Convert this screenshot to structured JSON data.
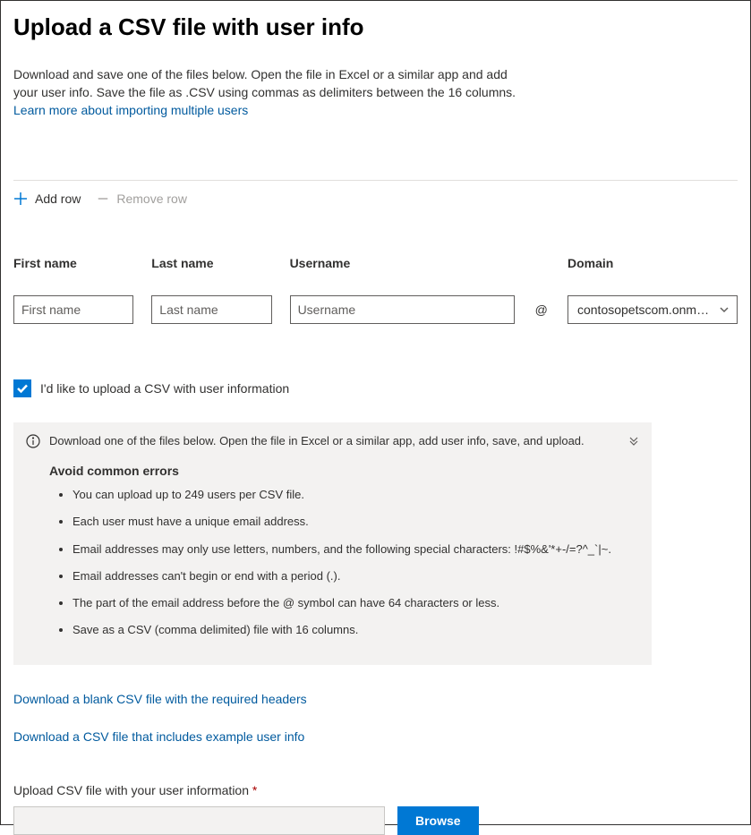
{
  "header": {
    "title": "Upload a CSV file with user info",
    "intro": "Download and save one of the files below. Open the file in Excel or a similar app and add your user info. Save the file as .CSV using commas as delimiters between the 16 columns.",
    "learn_link": "Learn more about importing multiple users"
  },
  "toolbar": {
    "add_row": "Add row",
    "remove_row": "Remove row"
  },
  "fields": {
    "first_name": {
      "label": "First name",
      "placeholder": "First name"
    },
    "last_name": {
      "label": "Last name",
      "placeholder": "Last name"
    },
    "username": {
      "label": "Username",
      "placeholder": "Username"
    },
    "at": "@",
    "domain": {
      "label": "Domain",
      "value": "contosopetscom.onmic..."
    }
  },
  "checkbox": {
    "label": "I'd like to upload a CSV with user information"
  },
  "info_panel": {
    "text": "Download one of the files below. Open the file in Excel or a similar app, add user info, save, and upload.",
    "avoid_title": "Avoid common errors",
    "errors": [
      "You can upload up to 249 users per CSV file.",
      "Each user must have a unique email address.",
      "Email addresses may only use letters, numbers, and the following special characters: !#$%&'*+-/=?^_`|~.",
      "Email addresses can't begin or end with a period (.).",
      "The part of the email address before the @ symbol can have 64 characters or less.",
      "Save as a CSV (comma delimited) file with 16 columns."
    ]
  },
  "download_links": {
    "blank": "Download a blank CSV file with the required headers",
    "example": "Download a CSV file that includes example user info"
  },
  "upload": {
    "label": "Upload CSV file with your user information",
    "required": "*",
    "browse": "Browse"
  }
}
